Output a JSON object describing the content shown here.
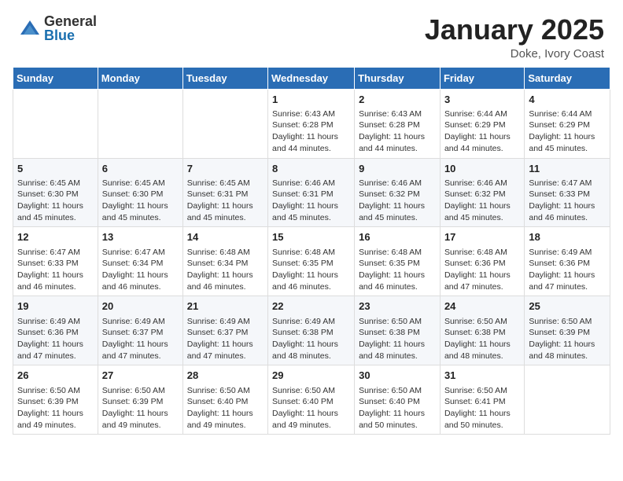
{
  "header": {
    "logo_general": "General",
    "logo_blue": "Blue",
    "month_title": "January 2025",
    "location": "Doke, Ivory Coast"
  },
  "days_of_week": [
    "Sunday",
    "Monday",
    "Tuesday",
    "Wednesday",
    "Thursday",
    "Friday",
    "Saturday"
  ],
  "weeks": [
    [
      {
        "day": "",
        "info": ""
      },
      {
        "day": "",
        "info": ""
      },
      {
        "day": "",
        "info": ""
      },
      {
        "day": "1",
        "info": "Sunrise: 6:43 AM\nSunset: 6:28 PM\nDaylight: 11 hours and 44 minutes."
      },
      {
        "day": "2",
        "info": "Sunrise: 6:43 AM\nSunset: 6:28 PM\nDaylight: 11 hours and 44 minutes."
      },
      {
        "day": "3",
        "info": "Sunrise: 6:44 AM\nSunset: 6:29 PM\nDaylight: 11 hours and 44 minutes."
      },
      {
        "day": "4",
        "info": "Sunrise: 6:44 AM\nSunset: 6:29 PM\nDaylight: 11 hours and 45 minutes."
      }
    ],
    [
      {
        "day": "5",
        "info": "Sunrise: 6:45 AM\nSunset: 6:30 PM\nDaylight: 11 hours and 45 minutes."
      },
      {
        "day": "6",
        "info": "Sunrise: 6:45 AM\nSunset: 6:30 PM\nDaylight: 11 hours and 45 minutes."
      },
      {
        "day": "7",
        "info": "Sunrise: 6:45 AM\nSunset: 6:31 PM\nDaylight: 11 hours and 45 minutes."
      },
      {
        "day": "8",
        "info": "Sunrise: 6:46 AM\nSunset: 6:31 PM\nDaylight: 11 hours and 45 minutes."
      },
      {
        "day": "9",
        "info": "Sunrise: 6:46 AM\nSunset: 6:32 PM\nDaylight: 11 hours and 45 minutes."
      },
      {
        "day": "10",
        "info": "Sunrise: 6:46 AM\nSunset: 6:32 PM\nDaylight: 11 hours and 45 minutes."
      },
      {
        "day": "11",
        "info": "Sunrise: 6:47 AM\nSunset: 6:33 PM\nDaylight: 11 hours and 46 minutes."
      }
    ],
    [
      {
        "day": "12",
        "info": "Sunrise: 6:47 AM\nSunset: 6:33 PM\nDaylight: 11 hours and 46 minutes."
      },
      {
        "day": "13",
        "info": "Sunrise: 6:47 AM\nSunset: 6:34 PM\nDaylight: 11 hours and 46 minutes."
      },
      {
        "day": "14",
        "info": "Sunrise: 6:48 AM\nSunset: 6:34 PM\nDaylight: 11 hours and 46 minutes."
      },
      {
        "day": "15",
        "info": "Sunrise: 6:48 AM\nSunset: 6:35 PM\nDaylight: 11 hours and 46 minutes."
      },
      {
        "day": "16",
        "info": "Sunrise: 6:48 AM\nSunset: 6:35 PM\nDaylight: 11 hours and 46 minutes."
      },
      {
        "day": "17",
        "info": "Sunrise: 6:48 AM\nSunset: 6:36 PM\nDaylight: 11 hours and 47 minutes."
      },
      {
        "day": "18",
        "info": "Sunrise: 6:49 AM\nSunset: 6:36 PM\nDaylight: 11 hours and 47 minutes."
      }
    ],
    [
      {
        "day": "19",
        "info": "Sunrise: 6:49 AM\nSunset: 6:36 PM\nDaylight: 11 hours and 47 minutes."
      },
      {
        "day": "20",
        "info": "Sunrise: 6:49 AM\nSunset: 6:37 PM\nDaylight: 11 hours and 47 minutes."
      },
      {
        "day": "21",
        "info": "Sunrise: 6:49 AM\nSunset: 6:37 PM\nDaylight: 11 hours and 47 minutes."
      },
      {
        "day": "22",
        "info": "Sunrise: 6:49 AM\nSunset: 6:38 PM\nDaylight: 11 hours and 48 minutes."
      },
      {
        "day": "23",
        "info": "Sunrise: 6:50 AM\nSunset: 6:38 PM\nDaylight: 11 hours and 48 minutes."
      },
      {
        "day": "24",
        "info": "Sunrise: 6:50 AM\nSunset: 6:38 PM\nDaylight: 11 hours and 48 minutes."
      },
      {
        "day": "25",
        "info": "Sunrise: 6:50 AM\nSunset: 6:39 PM\nDaylight: 11 hours and 48 minutes."
      }
    ],
    [
      {
        "day": "26",
        "info": "Sunrise: 6:50 AM\nSunset: 6:39 PM\nDaylight: 11 hours and 49 minutes."
      },
      {
        "day": "27",
        "info": "Sunrise: 6:50 AM\nSunset: 6:39 PM\nDaylight: 11 hours and 49 minutes."
      },
      {
        "day": "28",
        "info": "Sunrise: 6:50 AM\nSunset: 6:40 PM\nDaylight: 11 hours and 49 minutes."
      },
      {
        "day": "29",
        "info": "Sunrise: 6:50 AM\nSunset: 6:40 PM\nDaylight: 11 hours and 49 minutes."
      },
      {
        "day": "30",
        "info": "Sunrise: 6:50 AM\nSunset: 6:40 PM\nDaylight: 11 hours and 50 minutes."
      },
      {
        "day": "31",
        "info": "Sunrise: 6:50 AM\nSunset: 6:41 PM\nDaylight: 11 hours and 50 minutes."
      },
      {
        "day": "",
        "info": ""
      }
    ]
  ]
}
